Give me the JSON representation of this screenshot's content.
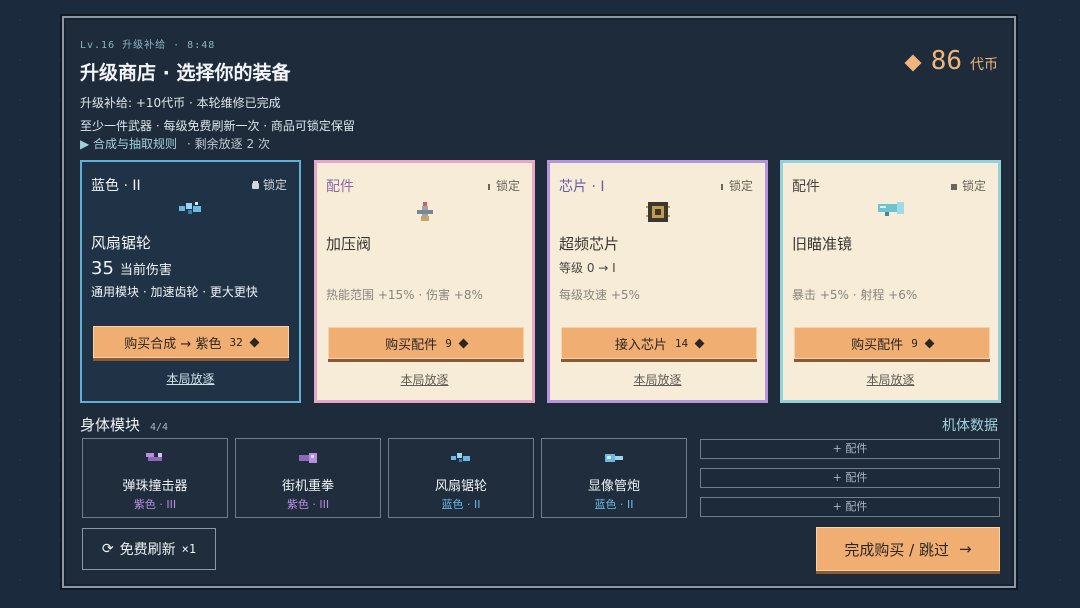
{
  "header": {
    "subtitle": "Lv.16 升级补给 · 8:48",
    "title": "升级商店 · 选择你的装备",
    "coins_value": "86",
    "coins_label": "代币",
    "info_line1": "升级补给: +10代币 · 本轮维修已完成",
    "info_line2": "至少一件武器 · 每级免费刷新一次 · 商品可锁定保留",
    "rules_link": "▶ 合成与抽取规则",
    "banish_remaining": "· 剩余放逐 2 次"
  },
  "cards": [
    {
      "type": "蓝色 · II",
      "lock": "锁定",
      "name": "风扇锯轮",
      "stat_value": "35",
      "stat_label": "当前伤害",
      "desc": "通用模块 · 加速齿轮 · 更大更快",
      "buy_label": "购买合成 → 紫色",
      "price": "32",
      "banish": "本局放逐"
    },
    {
      "type": "配件",
      "lock": "锁定",
      "name": "加压阀",
      "desc": "热能范围 +15% · 伤害 +8%",
      "buy_label": "购买配件",
      "price": "9",
      "banish": "本局放逐"
    },
    {
      "type": "芯片 · I",
      "lock": "锁定",
      "name": "超频芯片",
      "stat": "等级 0 → I",
      "desc": "每级攻速 +5%",
      "buy_label": "接入芯片",
      "price": "14",
      "banish": "本局放逐"
    },
    {
      "type": "配件",
      "lock": "锁定",
      "name": "旧瞄准镜",
      "desc": "暴击 +5% · 射程 +6%",
      "buy_label": "购买配件",
      "price": "9",
      "banish": "本局放逐"
    }
  ],
  "modules": {
    "title": "身体模块",
    "count": "4/4",
    "stats_link": "机体数据",
    "items": [
      {
        "name": "弹珠撞击器",
        "rarity": "紫色 · III"
      },
      {
        "name": "街机重拳",
        "rarity": "紫色 · III"
      },
      {
        "name": "风扇锯轮",
        "rarity": "蓝色 · II"
      },
      {
        "name": "显像管炮",
        "rarity": "蓝色 · II"
      }
    ],
    "slots": [
      "+ 配件",
      "+ 配件",
      "+ 配件"
    ]
  },
  "footer": {
    "refresh_label": "免费刷新",
    "refresh_count": "×1",
    "done_label": "完成购买 / 跳过",
    "done_arrow": "→"
  },
  "colors": {
    "accent": "#f1ae72",
    "purple": "#b78ee0",
    "blue": "#6fb7e3",
    "panel": "#1d2b3b"
  }
}
